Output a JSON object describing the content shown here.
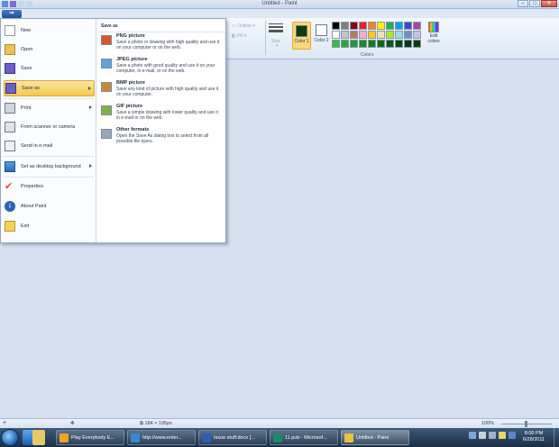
{
  "window": {
    "title": "Untitled - Paint",
    "minimize": "–",
    "maximize": "□",
    "close": "✕"
  },
  "ribbon": {
    "app_button": "▪▾",
    "outline_label": "Outline",
    "fill_label": "Fill",
    "size_label": "Size",
    "color1_label": "Color 1",
    "color2_label": "Color 2",
    "edit_colors_label": "Edit colors",
    "colors_group_label": "Colors",
    "color1_value": "#0a3d0a",
    "color2_value": "#ffffff",
    "palette": [
      "#000000",
      "#7f7f7f",
      "#880015",
      "#ed1c24",
      "#ff7f27",
      "#fff200",
      "#22b14c",
      "#00a2e8",
      "#3f48cc",
      "#a349a4",
      "#ffffff",
      "#c3c3c3",
      "#b97a57",
      "#ffaec9",
      "#ffc90e",
      "#efe4b0",
      "#b5e61d",
      "#99d9ea",
      "#7092be",
      "#c8bfe7",
      "#2fbf3f",
      "#28a838",
      "#1f9a30",
      "#1b8a2a",
      "#167a24",
      "#116a1e",
      "#0d5a18",
      "#094a12",
      "#063a0c",
      "#0a3d0a"
    ]
  },
  "app_menu": {
    "items": [
      {
        "label": "New",
        "icon": "new-file-icon"
      },
      {
        "label": "Open",
        "icon": "open-folder-icon"
      },
      {
        "label": "Save",
        "icon": "floppy-disk-icon"
      },
      {
        "label": "Save as",
        "icon": "save-as-icon"
      },
      {
        "label": "Print",
        "icon": "printer-icon"
      },
      {
        "label": "From scanner or camera",
        "icon": "scanner-icon"
      },
      {
        "label": "Send in e-mail",
        "icon": "email-icon"
      },
      {
        "label": "Set as desktop background",
        "icon": "desktop-background-icon"
      },
      {
        "label": "Properties",
        "icon": "checkmark-icon"
      },
      {
        "label": "About Paint",
        "icon": "info-icon"
      },
      {
        "label": "Exit",
        "icon": "exit-icon"
      }
    ],
    "save_as_header": "Save as",
    "save_as_options": [
      {
        "title": "PNG picture",
        "desc": "Save a photo or drawing with high quality and use it on your computer or on the web.",
        "color": "#d8562a"
      },
      {
        "title": "JPEG picture",
        "desc": "Save a photo with good quality and use it on your computer, in e-mail, or on the web.",
        "color": "#5fa3d9"
      },
      {
        "title": "BMP picture",
        "desc": "Save any kind of picture with high quality and use it on your computer.",
        "color": "#c28a3a"
      },
      {
        "title": "GIF picture",
        "desc": "Save a simple drawing with lower quality and use it in e-mail or on the web.",
        "color": "#7fb24a"
      },
      {
        "title": "Other formats",
        "desc": "Open the Save As dialog box to select from all possible file types.",
        "color": "#9aa7b8"
      }
    ]
  },
  "statusbar": {
    "add_icon": "+",
    "move_icon": "✥",
    "dimensions": "184 × 195px",
    "zoom": "100%",
    "zoom_level": 1.0
  },
  "taskbar": {
    "buttons": [
      {
        "label": "Play Everybody E...",
        "color": "#f2a21e"
      },
      {
        "label": "http://www.enter...",
        "color": "#3a86d8"
      },
      {
        "label": "Issue stuff.docx [...",
        "color": "#2f5fb3"
      },
      {
        "label": "11.pub - Microsof...",
        "color": "#1f8a6a"
      },
      {
        "label": "Untitled - Paint",
        "color": "#e8c23a"
      }
    ],
    "time": "8:00 PM",
    "date": "6/28/2011"
  }
}
